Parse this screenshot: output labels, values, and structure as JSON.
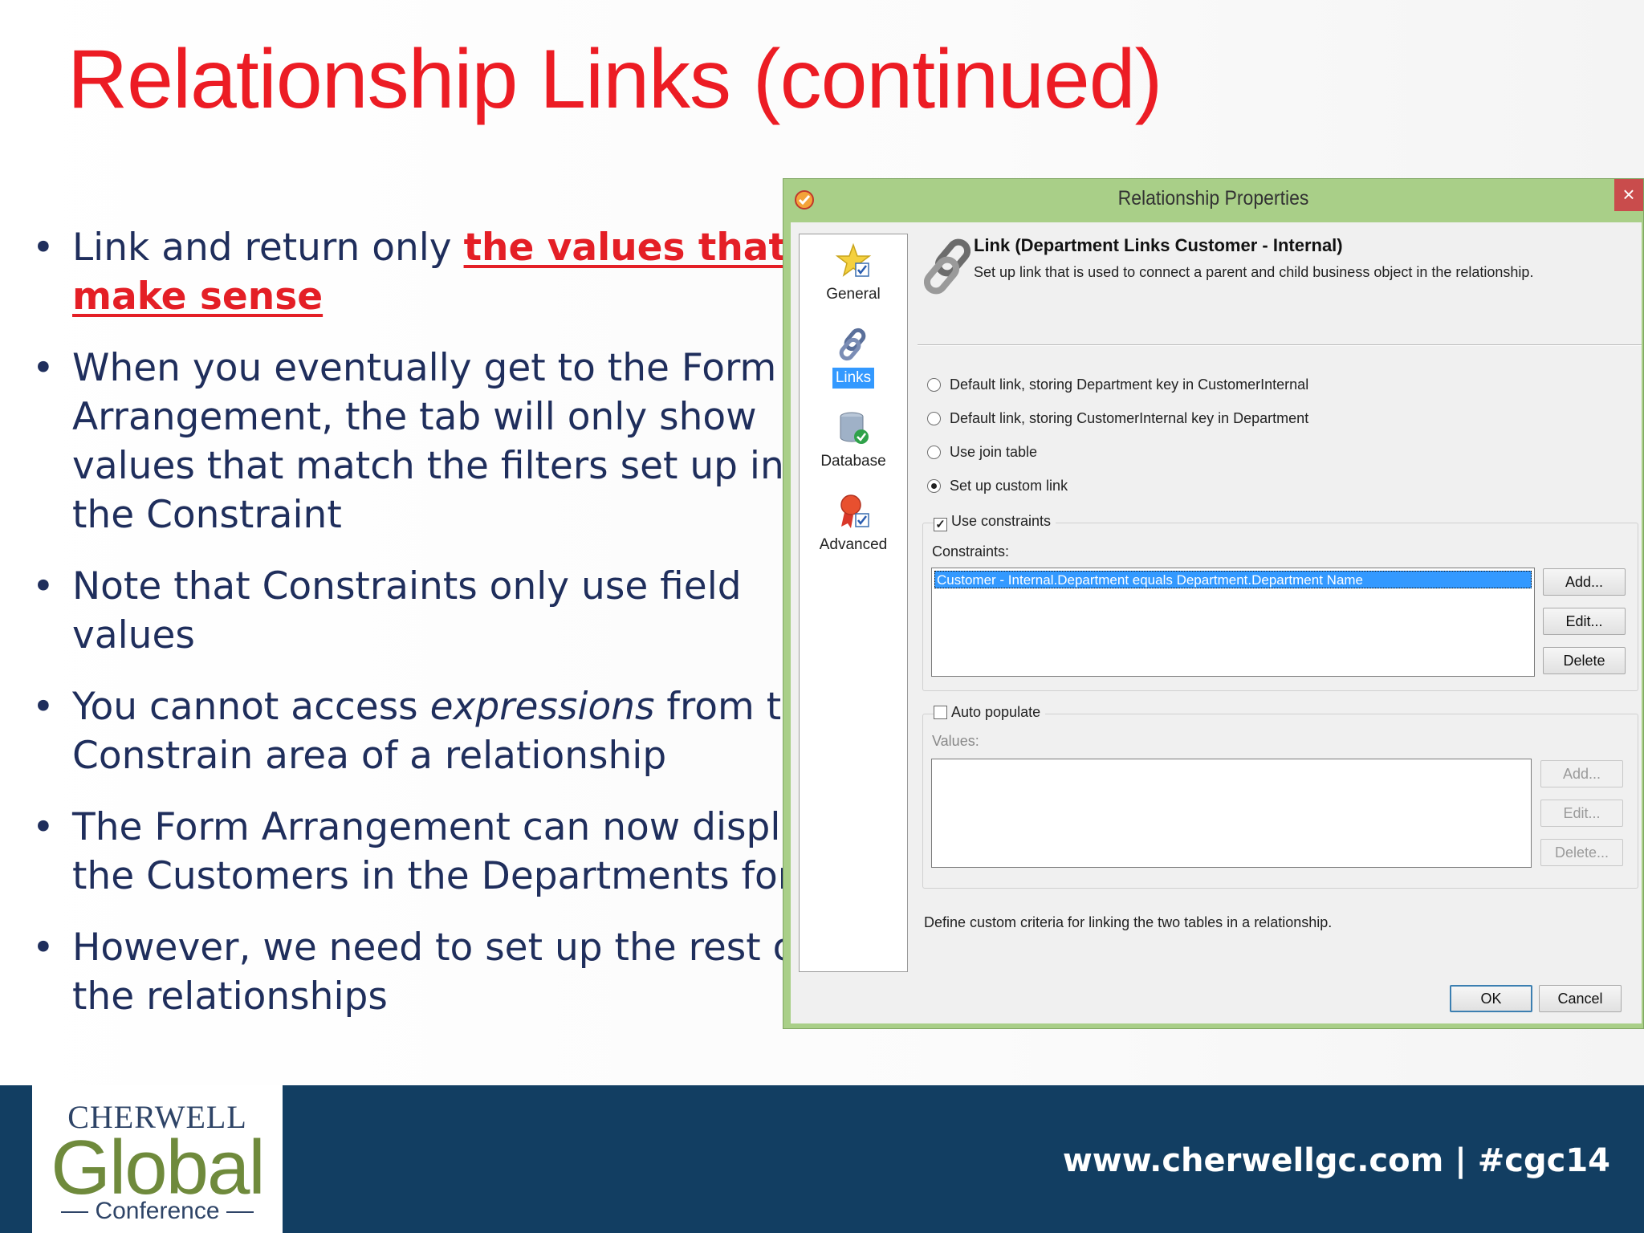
{
  "slide": {
    "title": "Relationship Links (continued)",
    "bullets": [
      {
        "pre": "Link and return only ",
        "highlight": "the values that make sense"
      },
      {
        "text": "When you eventually get to the Form Arrangement, the tab will only show values that match the filters set up in the Constraint"
      },
      {
        "text": "Note that Constraints only use field values"
      },
      {
        "pre": "You cannot access ",
        "italic": "expressions",
        "post": " from the Constrain area of a relationship"
      },
      {
        "text": "The Form Arrangement can now display the Customers in the Departments form"
      },
      {
        "text": "However, we need to set up the rest of the relationships"
      }
    ],
    "bullet_glyph": "•",
    "colors": {
      "title": "#ec1c24",
      "body": "#1f2e5c",
      "highlight": "#e41f26",
      "banner": "#123e62"
    }
  },
  "dialog": {
    "title": "Relationship Properties",
    "close_glyph": "×",
    "nav": [
      {
        "label": "General",
        "icon": "star-check-icon"
      },
      {
        "label": "Links",
        "icon": "chain-link-icon",
        "selected": true
      },
      {
        "label": "Database",
        "icon": "database-check-icon"
      },
      {
        "label": "Advanced",
        "icon": "ribbon-check-icon"
      }
    ],
    "header": {
      "title": "Link  (Department Links Customer - Internal)",
      "description": "Set up link that is used to connect a parent and child business object in the relationship.",
      "icon": "chain-link-icon"
    },
    "options": [
      {
        "label": "Default link, storing Department key in CustomerInternal",
        "checked": false
      },
      {
        "label": "Default link, storing CustomerInternal key in Department",
        "checked": false
      },
      {
        "label": "Use join table",
        "checked": false
      },
      {
        "label": "Set up custom link",
        "checked": true
      }
    ],
    "constraints": {
      "checkbox_label": "Use constraints",
      "checkbox_checked": true,
      "check_glyph": "✓",
      "list_label": "Constraints:",
      "items": [
        "Customer - Internal.Department equals Department.Department Name"
      ],
      "buttons": {
        "add": "Add...",
        "edit": "Edit...",
        "delete": "Delete"
      }
    },
    "auto_populate": {
      "checkbox_label": "Auto populate",
      "checkbox_checked": false,
      "list_label": "Values:",
      "buttons": {
        "add": "Add...",
        "edit": "Edit...",
        "delete": "Delete..."
      }
    },
    "footer_description": "Define custom criteria for linking the two tables in a relationship.",
    "ok": "OK",
    "cancel": "Cancel"
  },
  "banner": {
    "logo": {
      "top": "CHERWELL",
      "mid": "Global",
      "bottom": "Conference"
    },
    "site": "www.cherwellgc.com | #cgc14"
  }
}
